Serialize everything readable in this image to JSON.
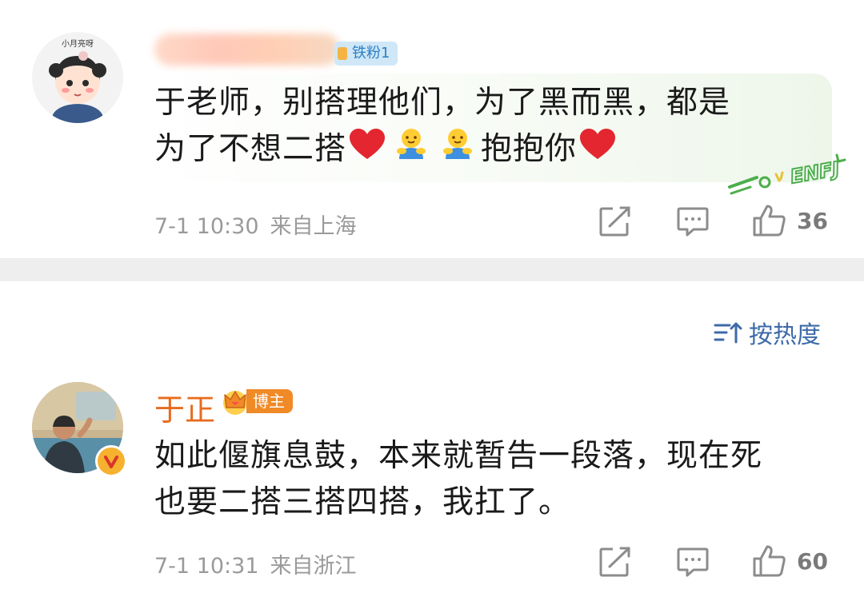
{
  "comment1": {
    "badge": "铁粉1",
    "text_line1": "于老师，别搭理他们，为了黑而黑，都是",
    "text_line2_a": "为了不想二搭",
    "text_line2_b": "抱抱你",
    "avatar_caption": "小月亮呀",
    "sticker_text": "ENFJ",
    "time": "7-1 10:30",
    "location": "来自上海",
    "likes": "36"
  },
  "sort": {
    "label": "按热度"
  },
  "comment2": {
    "author": "于正",
    "badge": "博主",
    "text_line1": "如此偃旗息鼓，本来就暂告一段落，现在死",
    "text_line2": "也要二搭三搭四搭，我扛了。",
    "time": "7-1 10:31",
    "location": "来自浙江",
    "likes": "60"
  },
  "colors": {
    "author": "#e86b1d",
    "link_blue": "#3d6aa8",
    "meta_gray": "#9a9a9a",
    "divider": "#eeeeee"
  },
  "icons": [
    "repost-icon",
    "comment-icon",
    "like-icon",
    "sort-icon",
    "heart-emoji-icon",
    "hug-emoji-icon",
    "crown-icon",
    "verified-icon"
  ]
}
